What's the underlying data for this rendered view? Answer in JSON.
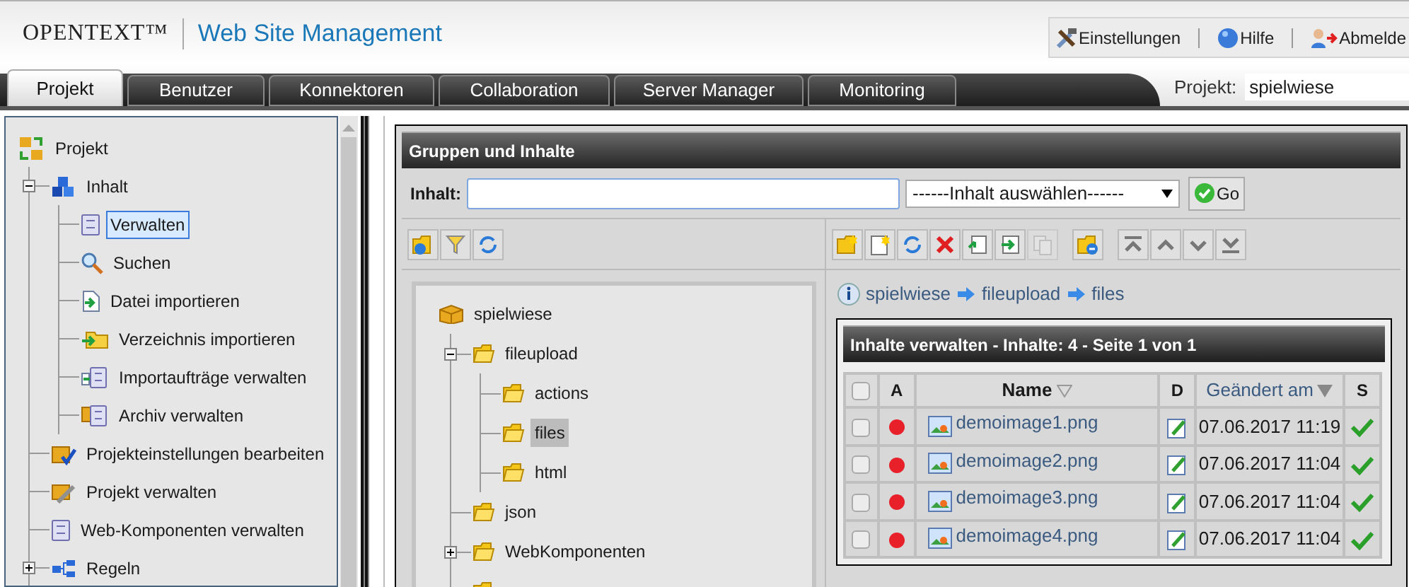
{
  "header": {
    "logo": "OPENTEXT™",
    "title": "Web Site Management",
    "links": [
      {
        "label": "Einstellungen"
      },
      {
        "label": "Hilfe"
      },
      {
        "label": "Abmelde"
      }
    ]
  },
  "tabs": [
    {
      "label": "Projekt",
      "selected": true
    },
    {
      "label": "Benutzer",
      "selected": false
    },
    {
      "label": "Konnektoren",
      "selected": false
    },
    {
      "label": "Collaboration",
      "selected": false
    },
    {
      "label": "Server Manager",
      "selected": false
    },
    {
      "label": "Monitoring",
      "selected": false
    }
  ],
  "project_selector": {
    "label": "Projekt:",
    "value": "spielwiese"
  },
  "nav_tree": [
    {
      "label": "Projekt",
      "selected": false,
      "children": [
        {
          "label": "Inhalt",
          "selected": false,
          "expanded": true,
          "children": [
            {
              "label": "Verwalten",
              "selected": true
            },
            {
              "label": "Suchen",
              "selected": false
            },
            {
              "label": "Datei importieren",
              "selected": false
            },
            {
              "label": "Verzeichnis importieren",
              "selected": false
            },
            {
              "label": "Importaufträge verwalten",
              "selected": false
            },
            {
              "label": "Archiv verwalten",
              "selected": false
            }
          ]
        },
        {
          "label": "Projekteinstellungen bearbeiten",
          "selected": false
        },
        {
          "label": "Projekt verwalten",
          "selected": false
        },
        {
          "label": "Web-Komponenten verwalten",
          "selected": false
        },
        {
          "label": "Regeln",
          "selected": false,
          "expanded": false
        }
      ]
    }
  ],
  "panel": {
    "title": "Gruppen und Inhalte",
    "content_field": {
      "label": "Inhalt:"
    },
    "dropdown": {
      "value": "------Inhalt auswählen------"
    },
    "go_button": "Go"
  },
  "folder_tree": [
    {
      "kind": "project",
      "label": "spielwiese",
      "selected": false,
      "children": [
        {
          "kind": "folder",
          "label": "fileupload",
          "selected": false,
          "expanded": true,
          "children": [
            {
              "kind": "folder",
              "label": "actions",
              "selected": false
            },
            {
              "kind": "folder",
              "label": "files",
              "selected": true
            },
            {
              "kind": "folder",
              "label": "html",
              "selected": false
            }
          ]
        },
        {
          "kind": "folder",
          "label": "json",
          "selected": false
        },
        {
          "kind": "folder",
          "label": "WebKomponenten",
          "selected": false,
          "expanded": false
        },
        {
          "kind": "folder"
        }
      ]
    }
  ],
  "breadcrumb": [
    "spielwiese",
    "fileupload",
    "files"
  ],
  "table": {
    "title": "Inhalte verwalten - Inhalte: 4 - Seite 1 von 1",
    "columns": [
      {
        "kind": "checkbox",
        "checked": false
      },
      {
        "kind": "text",
        "label": "A"
      },
      {
        "kind": "sortable",
        "label": "Name",
        "sorted": false
      },
      {
        "kind": "text",
        "label": "D"
      },
      {
        "kind": "sortable",
        "label": "Geändert am",
        "sorted": true
      },
      {
        "kind": "text",
        "label": "S"
      }
    ],
    "rows": [
      {
        "checked": false,
        "color": "#e8202a",
        "name": "demoimage1.png",
        "changed": "07.06.2017 11:19",
        "released": true
      },
      {
        "checked": false,
        "color": "#e8202a",
        "name": "demoimage2.png",
        "changed": "07.06.2017 11:04",
        "released": true
      },
      {
        "checked": false,
        "color": "#e8202a",
        "name": "demoimage3.png",
        "changed": "07.06.2017 11:04",
        "released": true
      },
      {
        "checked": false,
        "color": "#e8202a",
        "name": "demoimage4.png",
        "changed": "07.06.2017 11:04",
        "released": true
      }
    ]
  }
}
